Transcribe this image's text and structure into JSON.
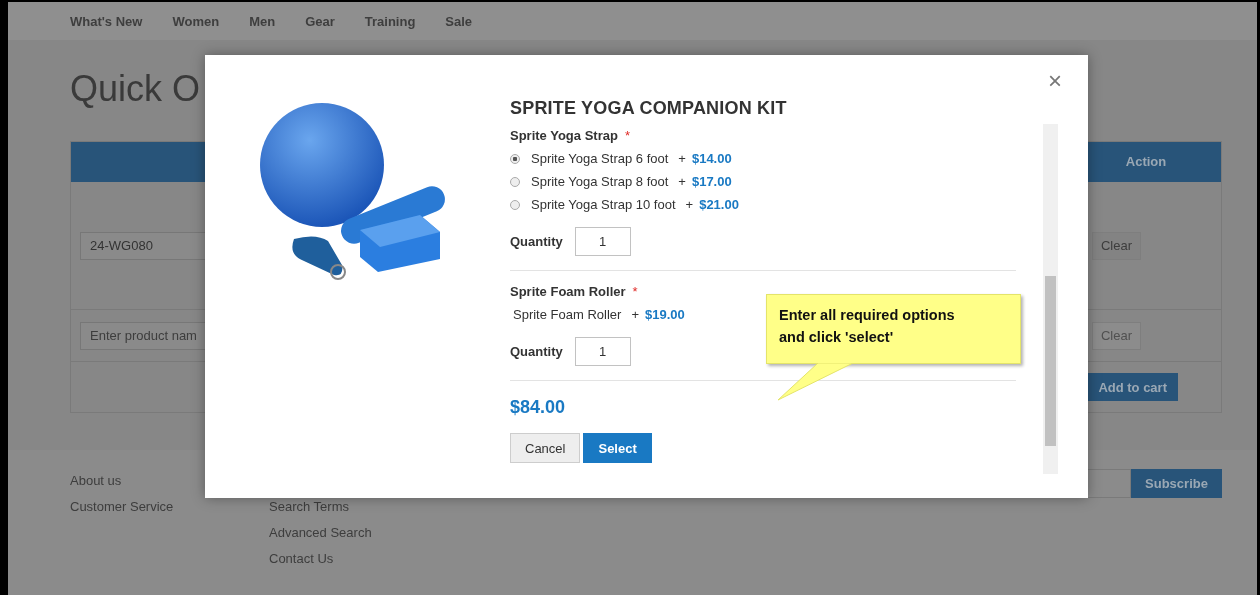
{
  "nav": [
    "What's New",
    "Women",
    "Men",
    "Gear",
    "Training",
    "Sale"
  ],
  "page_title": "Quick O",
  "table": {
    "action_header": "Action",
    "rows": [
      {
        "kind": "sku",
        "value": "24-WG080",
        "clear": "Clear",
        "clear_disabled": false
      },
      {
        "kind": "search",
        "placeholder": "Enter product nam",
        "clear": "Clear",
        "clear_disabled": true
      }
    ],
    "add_to_cart": "Add to cart"
  },
  "footer": {
    "column_1": [
      "About us",
      "Customer Service"
    ],
    "column_2": [
      "Search Terms",
      "Advanced Search",
      "Contact Us"
    ],
    "subscribe": "Subscribe"
  },
  "modal": {
    "title": "SPRITE YOGA COMPANION KIT",
    "close": "×",
    "options": [
      {
        "label": "Sprite Yoga Strap",
        "required_mark": "*",
        "kind": "radio",
        "choices": [
          {
            "label": "Sprite Yoga Strap 6 foot",
            "prefix": "+",
            "price": "$14.00",
            "selected": true
          },
          {
            "label": "Sprite Yoga Strap 8 foot",
            "prefix": "+",
            "price": "$17.00",
            "selected": false
          },
          {
            "label": "Sprite Yoga Strap 10 foot",
            "prefix": "+",
            "price": "$21.00",
            "selected": false
          }
        ],
        "quantity_label": "Quantity",
        "quantity": "1"
      },
      {
        "label": "Sprite Foam Roller",
        "required_mark": "*",
        "kind": "fixed",
        "choices": [
          {
            "label": "Sprite Foam Roller",
            "prefix": "+",
            "price": "$19.00"
          }
        ],
        "quantity_label": "Quantity",
        "quantity": "1"
      }
    ],
    "total": "$84.00",
    "buttons": [
      {
        "label": "Cancel",
        "kind": "secondary"
      },
      {
        "label": "Select",
        "kind": "primary"
      }
    ]
  },
  "callout": {
    "text": "Enter all required options and click 'select'"
  }
}
